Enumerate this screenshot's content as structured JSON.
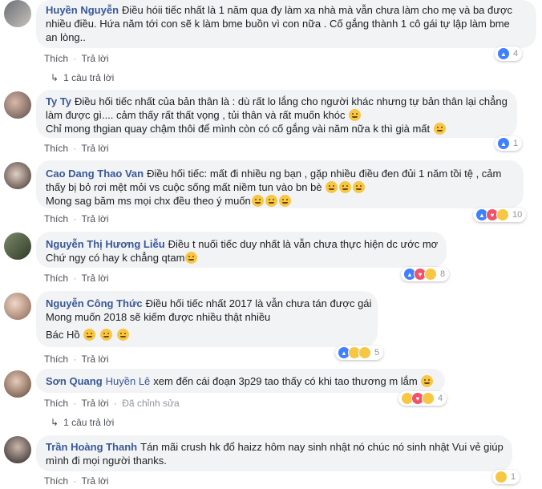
{
  "actions": {
    "like": "Thích",
    "reply": "Trả lời",
    "separator": "·",
    "edited": "Đã chỉnh sửa"
  },
  "comments": [
    {
      "name": "Huyền Nguyễn",
      "lines": [
        "Điều hóii tiếc nhất là 1 năm qua đy làm xa nhà mà vẫn chưa làm cho mẹ và ba được",
        "nhiều điều. Hứa năm tới con sẽ k làm bme buồn vì con nữa . Cố gắng thành 1 cô gái tự lập làm bme",
        "an lòng.."
      ],
      "reply_count": "1 câu trả lời",
      "reaction_count": "4"
    },
    {
      "name": "Ty Ty",
      "lines": [
        "Điều hối tiếc nhất của bản thân là : dù rất lo lắng cho người khác nhưng tự bản thân lại chẳng",
        "làm được gì.... cảm thấy rất thất vọng , tủi thân và rất muốn khóc",
        "Chỉ mong thgian quay chậm thôi để mình còn có cố gắng vài năm nữa k thì già mất"
      ],
      "reaction_count": "1"
    },
    {
      "name": "Cao Dang Thao Van",
      "lines": [
        "Điều hối tiếc: mất đi nhiều ng bạn , gặp nhiều điều đen đủi 1 năm tồi tệ , cảm",
        "thấy bị bỏ rơi mệt mỏi vs cuộc sống mất niềm tun vào bn bè",
        "Mong sag băm ms mọi chx đều theo ý muốn"
      ],
      "reaction_count": "10"
    },
    {
      "name": "Nguyễn Thị Hương Liễu",
      "lines": [
        "Điều t nuối tiếc duy nhất là vẫn chưa thực hiện dc ước mơ",
        "Chứ ngy có hay k chẳng qtam"
      ],
      "reaction_count": "8"
    },
    {
      "name": "Nguyễn Công Thức",
      "lines": [
        "Điều hối tiếc nhất 2017 là vẫn chưa tán được gái",
        "Mong muốn 2018 sẽ kiếm được nhiều thật nhiều",
        "Bác Hồ"
      ],
      "reaction_count": "5"
    },
    {
      "name": "Sơn Quang",
      "mention": "Huyền Lê",
      "lines": [
        "xem đến cái đoạn 3p29 tao thấy có khi tao thương m lắm"
      ],
      "reply_count": "1 câu trả lời",
      "reaction_count": "4"
    },
    {
      "name": "Trần Hoàng Thanh",
      "lines": [
        "Tán mãi crush hk đổ haizz hôm nay sinh nhật nó chúc nó sinh nhật Vui vẻ giúp",
        "mình đi mọi người thanks."
      ],
      "reaction_count": "1"
    }
  ],
  "colors": {
    "name": "#385898",
    "bubble": "#f2f3f5",
    "meta": "#90949c",
    "like": "#4080ff",
    "love": "#f25268",
    "emoji": "#f7c744"
  }
}
